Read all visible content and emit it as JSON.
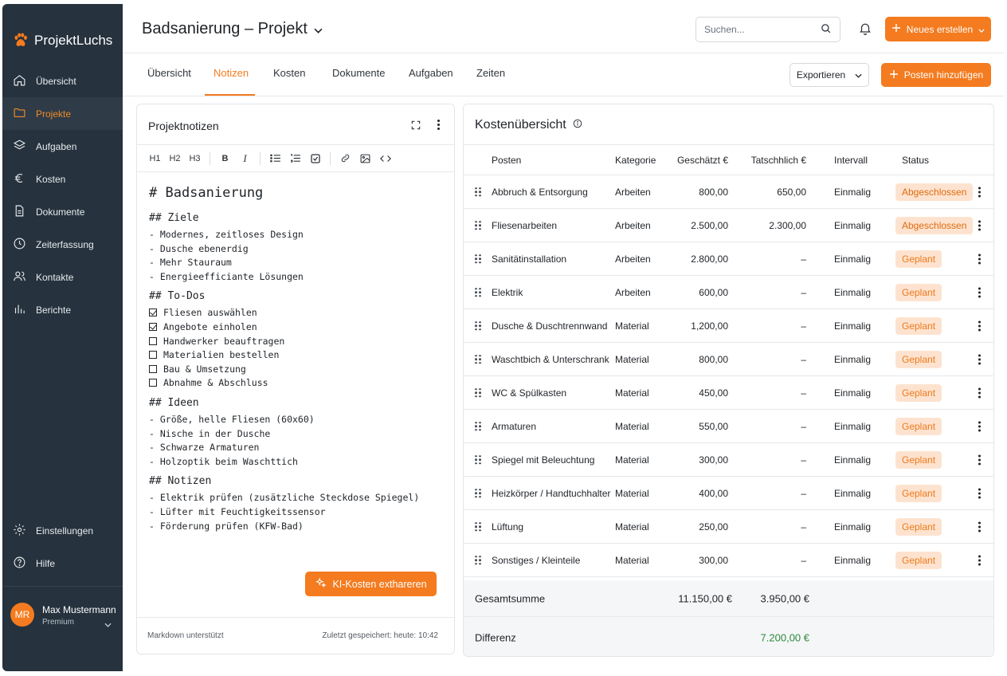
{
  "app": {
    "name": "ProjektLuchs"
  },
  "sidebar": {
    "items": [
      {
        "label": "Übersicht",
        "icon": "home-icon"
      },
      {
        "label": "Projekte",
        "icon": "folder-icon",
        "active": true
      },
      {
        "label": "Aufgaben",
        "icon": "layers-icon"
      },
      {
        "label": "Kosten",
        "icon": "euro-icon"
      },
      {
        "label": "Dokumente",
        "icon": "document-icon"
      },
      {
        "label": "Zeiterfassung",
        "icon": "clock-icon"
      },
      {
        "label": "Kontakte",
        "icon": "users-icon"
      },
      {
        "label": "Berichte",
        "icon": "bar-chart-icon"
      }
    ],
    "bottom_items": [
      {
        "label": "Einstellungen",
        "icon": "gear-icon"
      },
      {
        "label": "Hilfe",
        "icon": "help-icon"
      }
    ],
    "user": {
      "initials": "MR",
      "name": "Max Mustermann",
      "plan": "Premium"
    }
  },
  "header": {
    "project_title": "Badsanierung – Projekt",
    "search_placeholder": "Suchen...",
    "new_button": "Neues erstellen"
  },
  "tabs": {
    "items": [
      "Übersicht",
      "Notizen",
      "Kosten",
      "Dokumente",
      "Aufgaben",
      "Zeiten"
    ],
    "active": "Notizen",
    "export_button": "Exportieren",
    "add_button": "Posten hinzufügen"
  },
  "notes": {
    "title": "Projektnotizen",
    "toolbar": {
      "h1": "H1",
      "h2": "H2",
      "h3": "H3",
      "bold": "B",
      "italic": "I"
    },
    "h1": "# Badsanierung",
    "sections": [
      {
        "heading": "## Ziele",
        "type": "list",
        "items": [
          "- Modernes, zeitloses Design",
          "- Dusche ebenerdig",
          "- Mehr Stauraum",
          "- Energieefficiante Lösungen"
        ]
      },
      {
        "heading": "## To-Dos",
        "type": "todo",
        "items": [
          {
            "text": "Fliesen auswählen",
            "done": true
          },
          {
            "text": "Angebote einholen",
            "done": true
          },
          {
            "text": "Handwerker beauftragen",
            "done": false
          },
          {
            "text": "Materialien bestellen",
            "done": false
          },
          {
            "text": "Bau & Umsetzung",
            "done": false
          },
          {
            "text": "Abnahme & Abschluss",
            "done": false
          }
        ]
      },
      {
        "heading": "## Ideen",
        "type": "list",
        "items": [
          "- Größe, helle Fliesen (60x60)",
          "- Nische in der Dusche",
          "- Schwarze Armaturen",
          "- Holzoptik beim Waschttich"
        ]
      },
      {
        "heading": "## Notizen",
        "type": "list",
        "items": [
          "- Elektrik prüfen (zusätzliche Steckdose Spiegel)",
          "- Lüfter mit Feuchtigkeitssensor",
          "- Förderung prüfen (KFW-Bad)"
        ]
      }
    ],
    "ki_button": "KI-Kosten exthareren",
    "footer_left": "Markdown unterstützt",
    "footer_right": "Zuletzt gespeichert: heute: 10:42"
  },
  "costs": {
    "title": "Kostenübersicht",
    "columns": {
      "posten": "Posten",
      "kategorie": "Kategorie",
      "geschaetzt": "Geschätzt €",
      "tatsaechlich": "Tatschhlich €",
      "intervall": "Intervall",
      "status": "Status"
    },
    "rows": [
      {
        "posten": "Abbruch & Entsorgung",
        "kategorie": "Arbeiten",
        "geschaetzt": "800,00",
        "tatsaechlich": "650,00",
        "intervall": "Einmalig",
        "status": "Abgeschlossen"
      },
      {
        "posten": "Fliesenarbeiten",
        "kategorie": "Arbeiten",
        "geschaetzt": "2.500,00",
        "tatsaechlich": "2.300,00",
        "intervall": "Einmalig",
        "status": "Abgeschlossen"
      },
      {
        "posten": "Sanitätinstallation",
        "kategorie": "Arbeiten",
        "geschaetzt": "2.800,00",
        "tatsaechlich": "–",
        "intervall": "Einmalig",
        "status": "Geplant"
      },
      {
        "posten": "Elektrik",
        "kategorie": "Arbeiten",
        "geschaetzt": "600,00",
        "tatsaechlich": "–",
        "intervall": "Einmalig",
        "status": "Geplant"
      },
      {
        "posten": "Dusche & Duschtrennwand",
        "kategorie": "Material",
        "geschaetzt": "1,200,00",
        "tatsaechlich": "–",
        "intervall": "Einmalig",
        "status": "Geplant"
      },
      {
        "posten": "Waschtbich & Unterschrank",
        "kategorie": "Material",
        "geschaetzt": "800,00",
        "tatsaechlich": "–",
        "intervall": "Einmalig",
        "status": "Geplant"
      },
      {
        "posten": "WC & Spülkasten",
        "kategorie": "Material",
        "geschaetzt": "450,00",
        "tatsaechlich": "–",
        "intervall": "Einmalig",
        "status": "Geplant"
      },
      {
        "posten": "Armaturen",
        "kategorie": "Material",
        "geschaetzt": "550,00",
        "tatsaechlich": "–",
        "intervall": "Einmalig",
        "status": "Geplant"
      },
      {
        "posten": "Spiegel mit Beleuchtung",
        "kategorie": "Material",
        "geschaetzt": "300,00",
        "tatsaechlich": "–",
        "intervall": "Einmalig",
        "status": "Geplant"
      },
      {
        "posten": "Heizkörper / Handtuchhalter",
        "kategorie": "Material",
        "geschaetzt": "400,00",
        "tatsaechlich": "–",
        "intervall": "Einmalig",
        "status": "Geplant"
      },
      {
        "posten": "Lüftung",
        "kategorie": "Material",
        "geschaetzt": "250,00",
        "tatsaechlich": "–",
        "intervall": "Einmalig",
        "status": "Geplant"
      },
      {
        "posten": "Sonstiges / Kleinteile",
        "kategorie": "Material",
        "geschaetzt": "300,00",
        "tatsaechlich": "–",
        "intervall": "Einmalig",
        "status": "Geplant"
      }
    ],
    "total": {
      "label": "Gesamtsumme",
      "geschaetzt": "11.150,00 €",
      "tatsaechlich": "3.950,00 €"
    },
    "difference": {
      "label": "Differenz",
      "value": "7.200,00 €"
    }
  },
  "colors": {
    "accent": "#f47b1f",
    "sidebar_bg": "#26323d",
    "positive": "#2a8a3e"
  }
}
